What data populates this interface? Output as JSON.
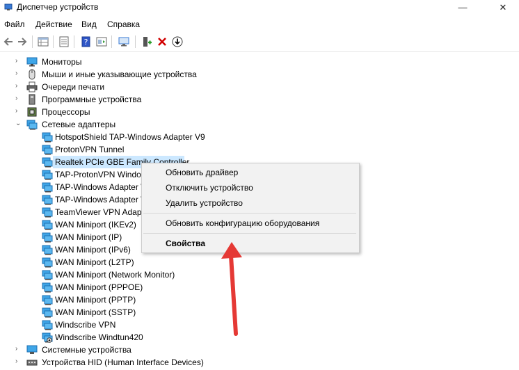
{
  "window": {
    "title": "Диспетчер устройств",
    "minimize_glyph": "—",
    "maximize_glyph": "☐",
    "close_glyph": "✕"
  },
  "menu": [
    "Файл",
    "Действие",
    "Вид",
    "Справка"
  ],
  "toolbar": {
    "icons": [
      "back-icon",
      "forward-icon",
      "properties-grid-icon",
      "list-icon",
      "help-icon",
      "update-icon",
      "monitor-scan-icon",
      "add-hardware-icon",
      "uninstall-icon",
      "download-icon"
    ],
    "accent_delete": "#d10000"
  },
  "tree": {
    "categories": [
      {
        "label": "Мониторы",
        "icon": "monitor-icon",
        "expanded": false
      },
      {
        "label": "Мыши и иные указывающие устройства",
        "icon": "mouse-icon",
        "expanded": false
      },
      {
        "label": "Очереди печати",
        "icon": "printer-icon",
        "expanded": false
      },
      {
        "label": "Программные устройства",
        "icon": "software-device-icon",
        "expanded": false
      },
      {
        "label": "Процессоры",
        "icon": "cpu-icon",
        "expanded": false
      },
      {
        "label": "Сетевые адаптеры",
        "icon": "network-adapter-icon",
        "expanded": true
      }
    ],
    "adapters": [
      "HotspotShield TAP-Windows Adapter V9",
      "ProtonVPN Tunnel",
      "Realtek PCIe GBE Family Controller",
      "TAP-ProtonVPN Windo",
      "TAP-Windows Adapter V",
      "TAP-Windows Adapter V",
      "TeamViewer VPN Adapt",
      "WAN Miniport (IKEv2)",
      "WAN Miniport (IP)",
      "WAN Miniport (IPv6)",
      "WAN Miniport (L2TP)",
      "WAN Miniport (Network Monitor)",
      "WAN Miniport (PPPOE)",
      "WAN Miniport (PPTP)",
      "WAN Miniport (SSTP)",
      "Windscribe VPN",
      "Windscribe Windtun420"
    ],
    "selected_adapter": "Realtek PCIe GBE Family Controller",
    "after": [
      {
        "label": "Системные устройства",
        "icon": "system-device-icon"
      },
      {
        "label": "Устройства HID (Human Interface Devices)",
        "icon": "hid-icon"
      }
    ],
    "selection_color": "#cce8ff"
  },
  "context_menu": {
    "items": [
      "Обновить драйвер",
      "Отключить устройство",
      "Удалить устройство",
      "Обновить конфигурацию оборудования",
      "Свойства"
    ]
  },
  "annotation": {
    "arrow_color": "#e53935"
  }
}
